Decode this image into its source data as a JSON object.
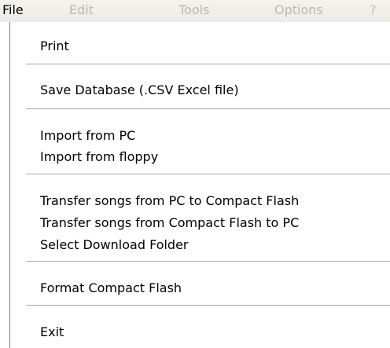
{
  "menubar": {
    "items": [
      {
        "label": "File"
      },
      {
        "label": "Edit"
      },
      {
        "label": "Tools"
      },
      {
        "label": "Options"
      },
      {
        "label": "?"
      }
    ]
  },
  "file_menu": {
    "print": "Print",
    "save_database": "Save Database (.CSV Excel file)",
    "import_pc": "Import from PC",
    "import_floppy": "Import from floppy",
    "transfer_pc_to_cf": "Transfer songs from PC to Compact Flash",
    "transfer_cf_to_pc": "Transfer songs from Compact Flash to PC",
    "select_download_folder": "Select Download Folder",
    "format_cf": "Format Compact Flash",
    "exit": "Exit"
  }
}
